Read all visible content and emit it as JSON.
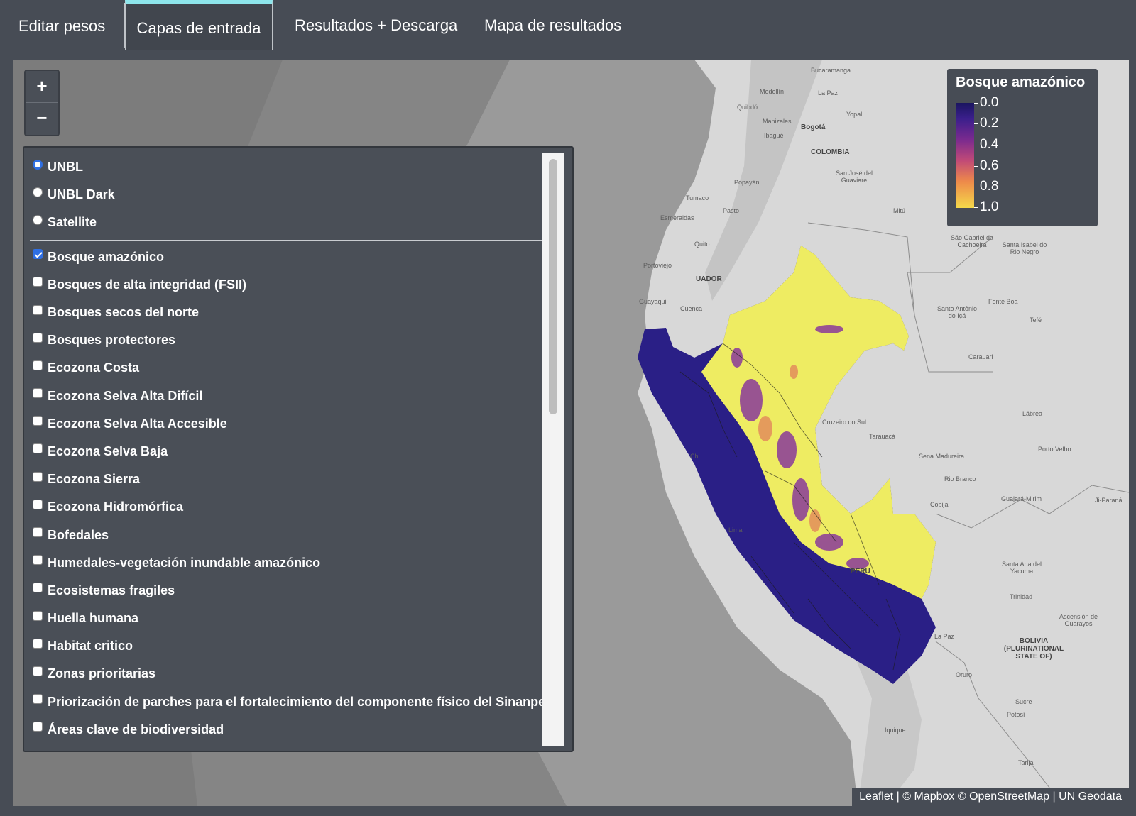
{
  "tabs": [
    {
      "label": "Editar pesos"
    },
    {
      "label": "Capas de entrada",
      "active": true
    },
    {
      "label": "Resultados + Descarga"
    },
    {
      "label": "Mapa de resultados"
    }
  ],
  "zoom": {
    "in_label": "+",
    "out_label": "−"
  },
  "layer_control": {
    "base_layers": [
      {
        "label": "UNBL",
        "selected": true
      },
      {
        "label": "UNBL Dark",
        "selected": false
      },
      {
        "label": "Satellite",
        "selected": false
      }
    ],
    "overlays": [
      {
        "label": "Bosque amazónico",
        "checked": true
      },
      {
        "label": "Bosques de alta integridad (FSII)",
        "checked": false
      },
      {
        "label": "Bosques secos del norte",
        "checked": false
      },
      {
        "label": "Bosques protectores",
        "checked": false
      },
      {
        "label": "Ecozona Costa",
        "checked": false
      },
      {
        "label": "Ecozona Selva Alta Difícil",
        "checked": false
      },
      {
        "label": "Ecozona Selva Alta Accesible",
        "checked": false
      },
      {
        "label": "Ecozona Selva Baja",
        "checked": false
      },
      {
        "label": "Ecozona Sierra",
        "checked": false
      },
      {
        "label": "Ecozona Hidromórfica",
        "checked": false
      },
      {
        "label": "Bofedales",
        "checked": false
      },
      {
        "label": "Humedales-vegetación inundable amazónico",
        "checked": false
      },
      {
        "label": "Ecosistemas fragiles",
        "checked": false
      },
      {
        "label": "Huella humana",
        "checked": false
      },
      {
        "label": "Habitat critico",
        "checked": false
      },
      {
        "label": "Zonas prioritarias",
        "checked": false
      },
      {
        "label": "Priorización de parches para el fortalecimiento del componente físico del Sinanpe",
        "checked": false
      },
      {
        "label": "Áreas clave de biodiversidad",
        "checked": false
      }
    ]
  },
  "legend": {
    "title": "Bosque amazónico",
    "labels": [
      "0.0",
      "0.2",
      "0.4",
      "0.6",
      "0.8",
      "1.0"
    ],
    "colors": {
      "low": "#1a1560",
      "high": "#f4d84a"
    }
  },
  "map_labels": [
    {
      "text": "Bucaramanga"
    },
    {
      "text": "Medellín"
    },
    {
      "text": "La Paz"
    },
    {
      "text": "Quibdó"
    },
    {
      "text": "Manizales"
    },
    {
      "text": "Yopal"
    },
    {
      "text": "Ibagué"
    },
    {
      "text": "Bogotá"
    },
    {
      "text": "COLOMBIA"
    },
    {
      "text": "San José del Guaviare"
    },
    {
      "text": "Popayán"
    },
    {
      "text": "Tumaco"
    },
    {
      "text": "Pasto"
    },
    {
      "text": "Esmeraldas"
    },
    {
      "text": "Mitú"
    },
    {
      "text": "Quito"
    },
    {
      "text": "Portoviejo"
    },
    {
      "text": "UADOR"
    },
    {
      "text": "Guayaquil"
    },
    {
      "text": "Cuenca"
    },
    {
      "text": "São Gabriel da Cachoeira"
    },
    {
      "text": "Santa Isabel do Rio Negro"
    },
    {
      "text": "Santo Antônio do Içá"
    },
    {
      "text": "Fonte Boa"
    },
    {
      "text": "Tefé"
    },
    {
      "text": "Carauari"
    },
    {
      "text": "Cruzeiro do Sul"
    },
    {
      "text": "Tarauacá"
    },
    {
      "text": "Lábrea"
    },
    {
      "text": "Sena Madureira"
    },
    {
      "text": "Porto Velho"
    },
    {
      "text": "Rio Branco"
    },
    {
      "text": "Cobija"
    },
    {
      "text": "Guajará-Mirim"
    },
    {
      "text": "Ji-Paraná"
    },
    {
      "text": "Lima"
    },
    {
      "text": "PERU"
    },
    {
      "text": "Santa Ana del Yacuma"
    },
    {
      "text": "Trinidad"
    },
    {
      "text": "Ascensión de Guarayos"
    },
    {
      "text": "La Paz"
    },
    {
      "text": "BOLIVIA (PLURINATIONAL STATE OF)"
    },
    {
      "text": "Oruro"
    },
    {
      "text": "Sucre"
    },
    {
      "text": "Potosí"
    },
    {
      "text": "Iquique"
    },
    {
      "text": "Tarija"
    },
    {
      "text": "Chi"
    }
  ],
  "attribution": "Leaflet | © Mapbox © OpenStreetMap | UN Geodata"
}
